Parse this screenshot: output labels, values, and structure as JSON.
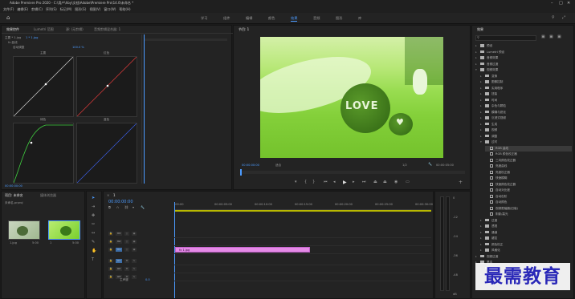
{
  "app": {
    "title": "Adobe Premiere Pro 2020 - C:\\用户\\hby\\文档\\Adobe\\Premiere Pro\\14.0\\未命名 *"
  },
  "menu": [
    "文件(F)",
    "编辑(E)",
    "剪辑(C)",
    "序列(S)",
    "标记(M)",
    "图形(G)",
    "视图(V)",
    "窗口(W)",
    "帮助(H)"
  ],
  "workspaces": [
    {
      "label": "学习",
      "active": false
    },
    {
      "label": "组件",
      "active": false
    },
    {
      "label": "编辑",
      "active": false
    },
    {
      "label": "颜色",
      "active": false
    },
    {
      "label": "效果",
      "active": true
    },
    {
      "label": "音频",
      "active": false
    },
    {
      "label": "图形",
      "active": false
    },
    {
      "label": "库",
      "active": false
    }
  ],
  "effect_controls": {
    "tabs": [
      "效果控件",
      "Lumetri 范围",
      "源: (无剪辑)",
      "音频剪辑混合器: 1"
    ],
    "row1": "主要 * 1.jpg",
    "row1b": "1 * 1.jpg",
    "row2": "fx 曲线",
    "row3": "自动调整",
    "row3val": "100.0 %",
    "curves": [
      {
        "label": "主要",
        "color": "#e0e0e0"
      },
      {
        "label": "红色",
        "color": "#e03b3b"
      },
      {
        "label": "绿色",
        "color": "#40d040"
      },
      {
        "label": "蓝色",
        "color": "#3b5de0"
      }
    ],
    "timecode": "00:00:00:00"
  },
  "program": {
    "title": "节目: 1",
    "timecode": "00:00:00:00",
    "fit": "适合",
    "ratio": "1/2",
    "duration": "00:00:05:00"
  },
  "photo": {
    "text": "LOVE"
  },
  "project": {
    "tabs": [
      "项目: 未命名",
      "媒体浏览器"
    ],
    "name": "未命名.prproj",
    "clips": [
      {
        "name": "1.jpg",
        "dur": "5:00"
      },
      {
        "name": "1",
        "dur": "5:00"
      }
    ]
  },
  "timeline": {
    "title": "1",
    "timecode": "00:00:00:00",
    "ruler": [
      ":00:00",
      "00:00:05:00",
      "00:00:10:00",
      "00:00:15:00",
      "00:00:20:00",
      "00:00:25:00",
      "00:00:30:00"
    ],
    "vtracks": [
      "V3",
      "V2",
      "V1"
    ],
    "atracks": [
      "A1",
      "A2",
      "A3"
    ],
    "master": "主声道",
    "master_val": "0.0",
    "clip": "1.jpg"
  },
  "effects": {
    "title": "效果",
    "items": [
      {
        "label": "预设",
        "indent": 0,
        "type": "folder",
        "open": false
      },
      {
        "label": "Lumetri 预设",
        "indent": 0,
        "type": "folder",
        "open": false
      },
      {
        "label": "音频效果",
        "indent": 0,
        "type": "folder",
        "open": false
      },
      {
        "label": "音频过渡",
        "indent": 0,
        "type": "folder",
        "open": false
      },
      {
        "label": "视频效果",
        "indent": 0,
        "type": "folder",
        "open": true
      },
      {
        "label": "变换",
        "indent": 1,
        "type": "folder",
        "open": false
      },
      {
        "label": "图像控制",
        "indent": 1,
        "type": "folder",
        "open": false
      },
      {
        "label": "实用程序",
        "indent": 1,
        "type": "folder",
        "open": false
      },
      {
        "label": "扭曲",
        "indent": 1,
        "type": "folder",
        "open": false
      },
      {
        "label": "时间",
        "indent": 1,
        "type": "folder",
        "open": false
      },
      {
        "label": "杂色与颗粒",
        "indent": 1,
        "type": "folder",
        "open": false
      },
      {
        "label": "模糊与锐化",
        "indent": 1,
        "type": "folder",
        "open": false
      },
      {
        "label": "沉浸式视频",
        "indent": 1,
        "type": "folder",
        "open": false
      },
      {
        "label": "生成",
        "indent": 1,
        "type": "folder",
        "open": false
      },
      {
        "label": "视频",
        "indent": 1,
        "type": "folder",
        "open": false
      },
      {
        "label": "调整",
        "indent": 1,
        "type": "folder",
        "open": false
      },
      {
        "label": "过时",
        "indent": 1,
        "type": "folder",
        "open": true
      },
      {
        "label": "RGB 曲线",
        "indent": 2,
        "type": "fx",
        "selected": true
      },
      {
        "label": "RGB 颜色校正器",
        "indent": 2,
        "type": "fx"
      },
      {
        "label": "三向颜色校正器",
        "indent": 2,
        "type": "fx"
      },
      {
        "label": "亮度曲线",
        "indent": 2,
        "type": "fx"
      },
      {
        "label": "亮度校正器",
        "indent": 2,
        "type": "fx"
      },
      {
        "label": "快速模糊",
        "indent": 2,
        "type": "fx"
      },
      {
        "label": "快速颜色校正器",
        "indent": 2,
        "type": "fx"
      },
      {
        "label": "自动对比度",
        "indent": 2,
        "type": "fx"
      },
      {
        "label": "自动色阶",
        "indent": 2,
        "type": "fx"
      },
      {
        "label": "自动颜色",
        "indent": 2,
        "type": "fx"
      },
      {
        "label": "视频限幅器(旧版)",
        "indent": 2,
        "type": "fx"
      },
      {
        "label": "阴影/高光",
        "indent": 2,
        "type": "fx"
      },
      {
        "label": "过渡",
        "indent": 1,
        "type": "folder",
        "open": false
      },
      {
        "label": "透视",
        "indent": 1,
        "type": "folder",
        "open": false
      },
      {
        "label": "通道",
        "indent": 1,
        "type": "folder",
        "open": false
      },
      {
        "label": "键控",
        "indent": 1,
        "type": "folder",
        "open": false
      },
      {
        "label": "颜色校正",
        "indent": 1,
        "type": "folder",
        "open": false
      },
      {
        "label": "风格化",
        "indent": 1,
        "type": "folder",
        "open": false
      },
      {
        "label": "视频过渡",
        "indent": 0,
        "type": "folder",
        "open": false
      },
      {
        "label": "基本",
        "indent": 0,
        "type": "folder",
        "open": false
      },
      {
        "label": "内滑",
        "indent": 1,
        "type": "folder",
        "open": false
      },
      {
        "label": "划像",
        "indent": 1,
        "type": "folder",
        "open": false
      }
    ]
  },
  "audio_meter": {
    "labels": [
      "0",
      "-12",
      "-24",
      "-36",
      "-48"
    ],
    "db": "dB"
  },
  "watermark": "最需教育",
  "colors": {
    "accent": "#4c9bff",
    "clip": "#e48ae6",
    "photo_green": "#8ad83c"
  }
}
